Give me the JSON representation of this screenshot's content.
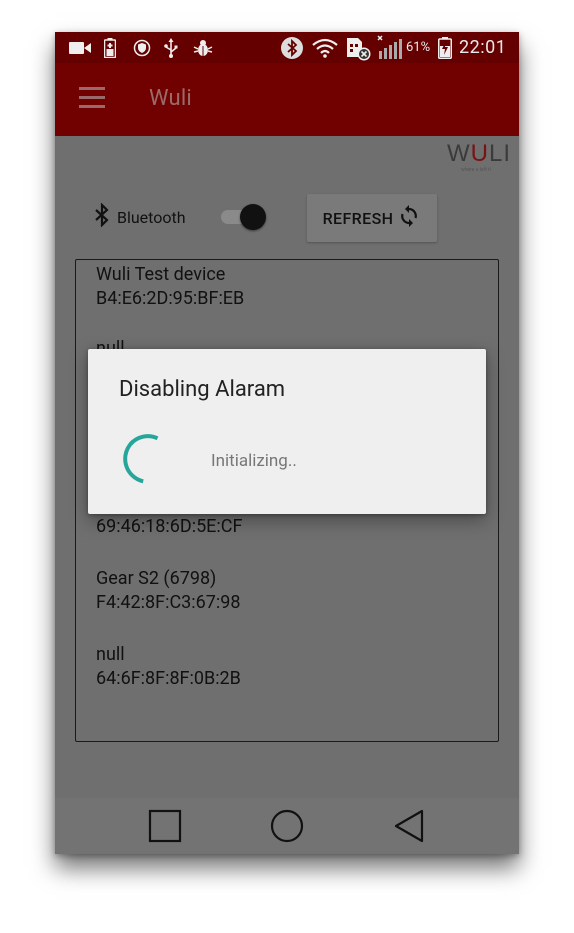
{
  "status_bar": {
    "battery_percent": "61%",
    "time": "22:01",
    "left_icons": [
      "video-camera-icon",
      "battery-saver-icon",
      "shield-icon",
      "usb-icon",
      "bug-icon"
    ],
    "right_icons": [
      "bluetooth-icon",
      "wifi-icon",
      "sim-error-icon",
      "signal-icon",
      "battery-charging-icon"
    ]
  },
  "app_bar": {
    "title": "Wuli",
    "menu_icon": "hamburger-menu-icon"
  },
  "logo": {
    "text_w": "W",
    "text_u": "U",
    "text_li": "LI",
    "tagline": "where u left it"
  },
  "bluetooth": {
    "label": "Bluetooth",
    "icon": "bluetooth-icon",
    "enabled": true
  },
  "refresh_button": {
    "label": "REFRESH",
    "icon": "refresh-icon"
  },
  "devices": [
    {
      "name": "Wuli Test device",
      "address": "B4:E6:2D:95:BF:EB"
    },
    {
      "name": "null",
      "address": ""
    },
    {
      "name": "",
      "address": "69:46:18:6D:5E:CF"
    },
    {
      "name": "Gear S2 (6798)",
      "address": "F4:42:8F:C3:67:98"
    },
    {
      "name": "null",
      "address": "64:6F:8F:8F:0B:2B"
    }
  ],
  "dialog": {
    "title": "Disabling Alaram",
    "message": "Initializing..",
    "accent_color": "#26a69a"
  },
  "nav_bar": {
    "icons": [
      "recents-square-icon",
      "home-circle-icon",
      "back-triangle-icon"
    ]
  },
  "colors": {
    "status_bar": "#640000",
    "app_bar": "#710000",
    "background": "#6f6f6f",
    "dialog": "#efefef"
  }
}
